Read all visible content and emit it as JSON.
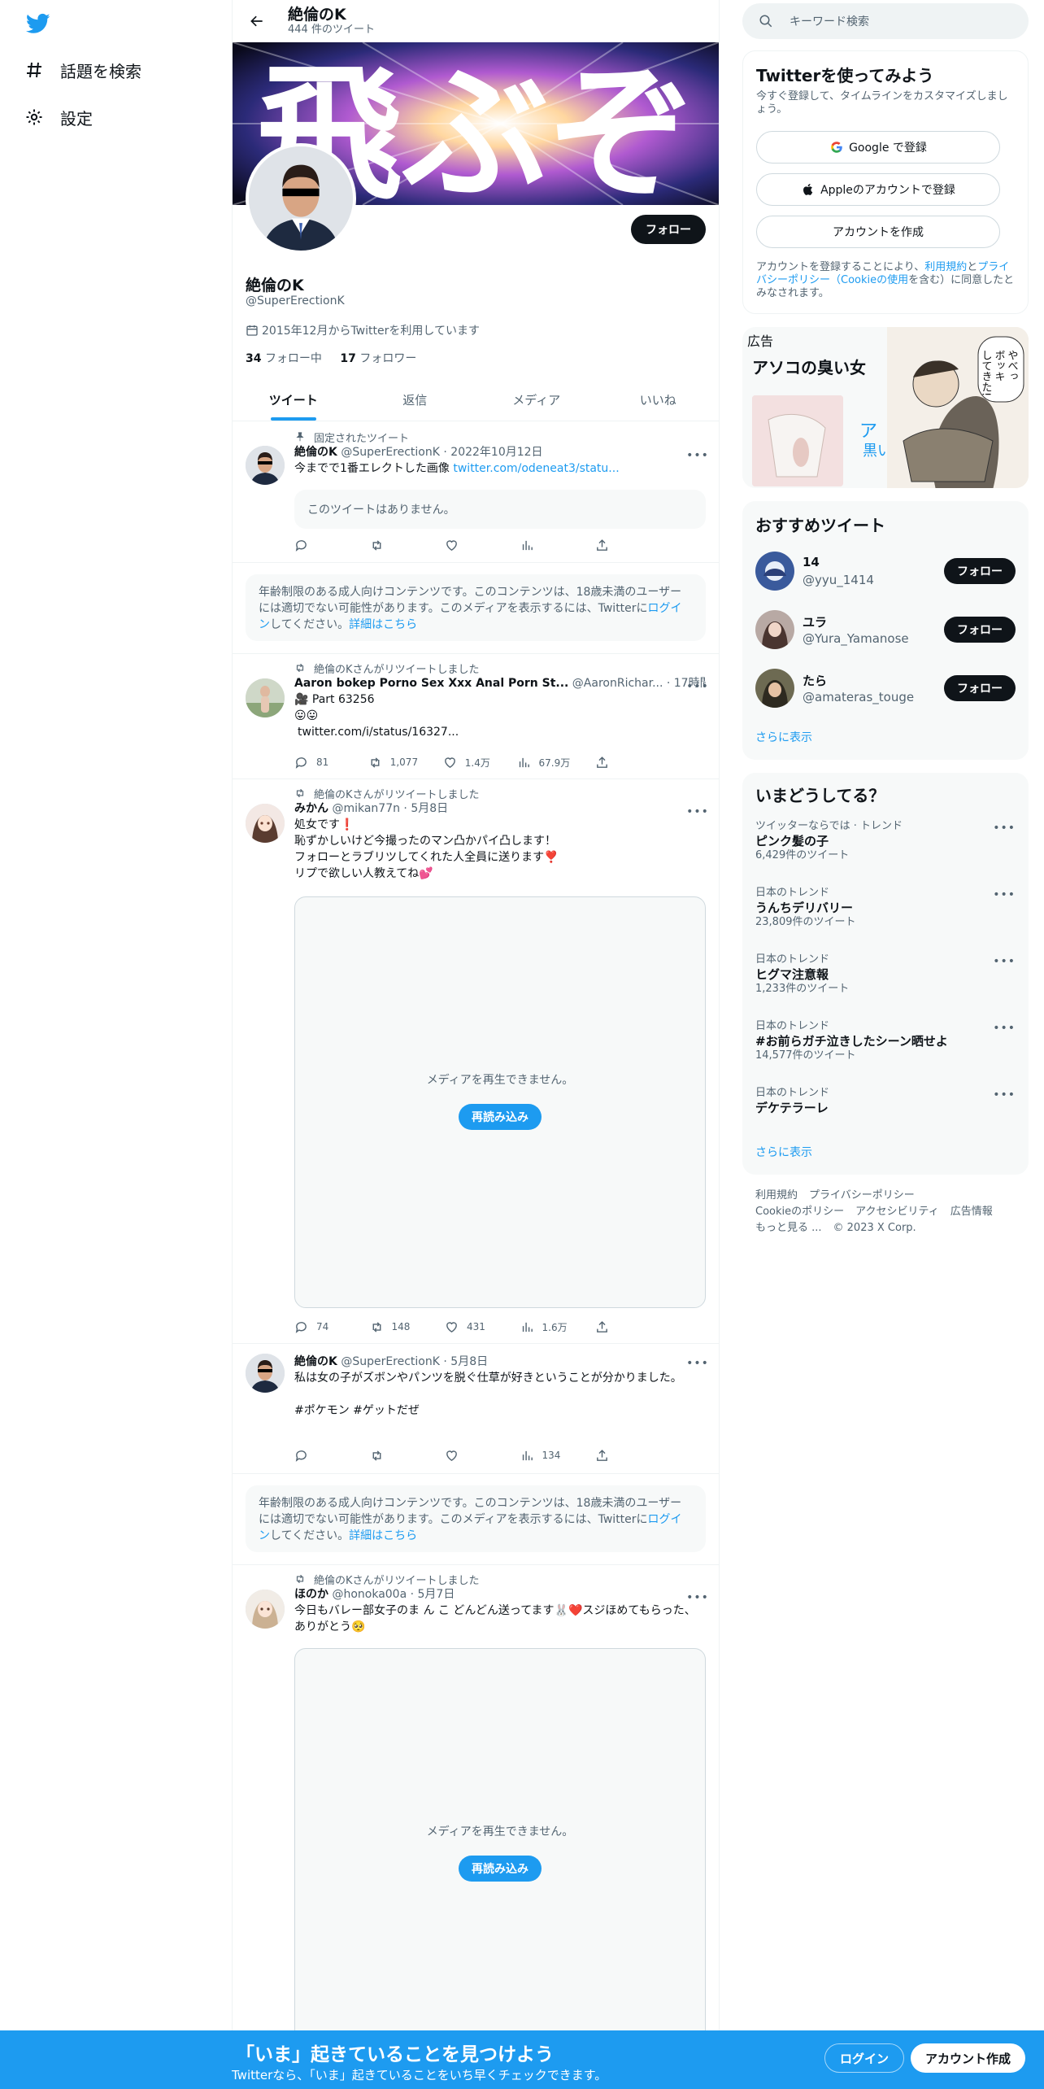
{
  "nav": {
    "logo_icon": "twitter-bird-icon",
    "explore_label": "話題を検索",
    "settings_label": "設定"
  },
  "header": {
    "name": "絶倫のK",
    "tweet_count": "444 件のツイート"
  },
  "banner": {
    "text": "飛ぶぞ"
  },
  "profile": {
    "follow_label": "フォロー",
    "name": "絶倫のK",
    "handle": "@SuperErectionK",
    "joined": "2015年12月からTwitterを利用しています",
    "following_count": "34",
    "following_label": "フォロー中",
    "followers_count": "17",
    "followers_label": "フォロワー"
  },
  "tabs": [
    "ツイート",
    "返信",
    "メディア",
    "いいね"
  ],
  "tweets": {
    "pinned": {
      "meta": "固定されたツイート",
      "name": "絶倫のK",
      "handle_time": "@SuperErectionK · 2022年10月12日",
      "text": "今までで1番エレクトした画像 ",
      "link": "twitter.com/odeneat3/statu...",
      "quote": "このツイートはありません。"
    },
    "notice1": {
      "text1": "年齢制限のある成人向けコンテンツです。このコンテンツは、18歳未満のユーザーには適切でない可能性があります。このメディアを表示するには、Twitterに",
      "login": "ログイン",
      "text2": "してください。",
      "more": "詳細はこちら"
    },
    "rt1": {
      "meta": "絶倫のKさんがリツイートしました",
      "name": "Aaron bokep Porno Sex Xxx Anal Porn St...",
      "handle_time": "@AaronRichar... · 17時間",
      "line1": "🎥 Part 63256",
      "line2": "😛😛",
      "link": "twitter.com/i/status/16327...",
      "replies": "81",
      "retweets": "1,077",
      "likes": "1.4万",
      "views": "67.9万"
    },
    "rt2": {
      "meta": "絶倫のKさんがリツイートしました",
      "name": "みかん",
      "handle_time": "@mikan77n · 5月8日",
      "lines": [
        "処女です❗️",
        "恥ずかしいけど今撮ったのマン凸かパイ凸します！",
        "フォローとラブリツしてくれた人全員に送ります❣️",
        "リプで欲しい人教えてね💕"
      ],
      "media_msg": "メディアを再生できません。",
      "reload": "再読み込み",
      "replies": "74",
      "retweets": "148",
      "likes": "431",
      "views": "1.6万"
    },
    "own2": {
      "name": "絶倫のK",
      "handle_time": "@SuperErectionK · 5月8日",
      "text": "私は女の子がズボンやパンツを脱ぐ仕草が好きということが分かりました。",
      "tags": "#ポケモン #ゲットだぜ",
      "views": "134"
    },
    "notice2": {
      "text1": "年齢制限のある成人向けコンテンツです。このコンテンツは、18歳未満のユーザーには適切でない可能性があります。このメディアを表示するには、Twitterに",
      "login": "ログイン",
      "text2": "してください。",
      "more": "詳細はこちら"
    },
    "rt3": {
      "meta": "絶倫のKさんがリツイートしました",
      "name": "ほのか",
      "handle_time": "@honoka00a · 5月7日",
      "text": "今日もバレー部女子のま ん こ どんどん送ってます🐰❤️スジほめてもらった、ありがとう🥺",
      "media_msg": "メディアを再生できません。",
      "reload": "再読み込み"
    }
  },
  "search": {
    "placeholder": "キーワード検索"
  },
  "signup": {
    "title": "Twitterを使ってみよう",
    "sub": "今すぐ登録して、タイムラインをカスタマイズしましょう。",
    "google": "Google で登録",
    "apple": "Appleのアカウントで登録",
    "create": "アカウントを作成",
    "terms1": "アカウントを登録することにより、",
    "terms_link1": "利用規約",
    "terms2": "と",
    "terms_link2": "プライバシーポリシー（Cookieの使用",
    "terms3": "を含む）に同意したとみなされます。"
  },
  "ad": {
    "label": "広告",
    "title": "アソコの臭い女",
    "side_text1": "ア",
    "side_text2": "黒い",
    "manga_text1": "やべっ",
    "manga_text2": "ボッキ",
    "manga_text3": "してきた!"
  },
  "recommend": {
    "title": "おすすめツイート",
    "users": [
      {
        "name": "14",
        "handle": "@yyu_1414",
        "button": "フォロー"
      },
      {
        "name": "ユラ",
        "handle": "@Yura_Yamanose",
        "button": "フォロー"
      },
      {
        "name": "たら",
        "handle": "@amateras_touge",
        "button": "フォロー"
      }
    ],
    "more": "さらに表示"
  },
  "trends": {
    "title": "いまどうしてる？",
    "items": [
      {
        "ctx": "ツイッターならでは · トレンド",
        "name": "ピンク髪の子",
        "count": "6,429件のツイート"
      },
      {
        "ctx": "日本のトレンド",
        "name": "うんちデリバリー",
        "count": "23,809件のツイート"
      },
      {
        "ctx": "日本のトレンド",
        "name": "ヒグマ注意報",
        "count": "1,233件のツイート"
      },
      {
        "ctx": "日本のトレンド",
        "name": "#お前らガチ泣きしたシーン晒せよ",
        "count": "14,577件のツイート"
      },
      {
        "ctx": "日本のトレンド",
        "name": "デケテラーレ",
        "count": ""
      }
    ],
    "more": "さらに表示"
  },
  "footer": {
    "terms": "利用規約",
    "privacy": "プライバシーポリシー",
    "cookie": "Cookieのポリシー",
    "access": "アクセシビリティ",
    "ads": "広告情報",
    "more": "もっと見る ...",
    "copy": "© 2023 X Corp."
  },
  "bottom": {
    "title": "「いま」起きていることを見つけよう",
    "sub": "Twitterなら、「いま」起きていることをいち早くチェックできます。",
    "login": "ログイン",
    "signup": "アカウント作成"
  },
  "colors": {
    "accent": "#1d9bf0",
    "text": "#0f1419",
    "muted": "#536471"
  }
}
